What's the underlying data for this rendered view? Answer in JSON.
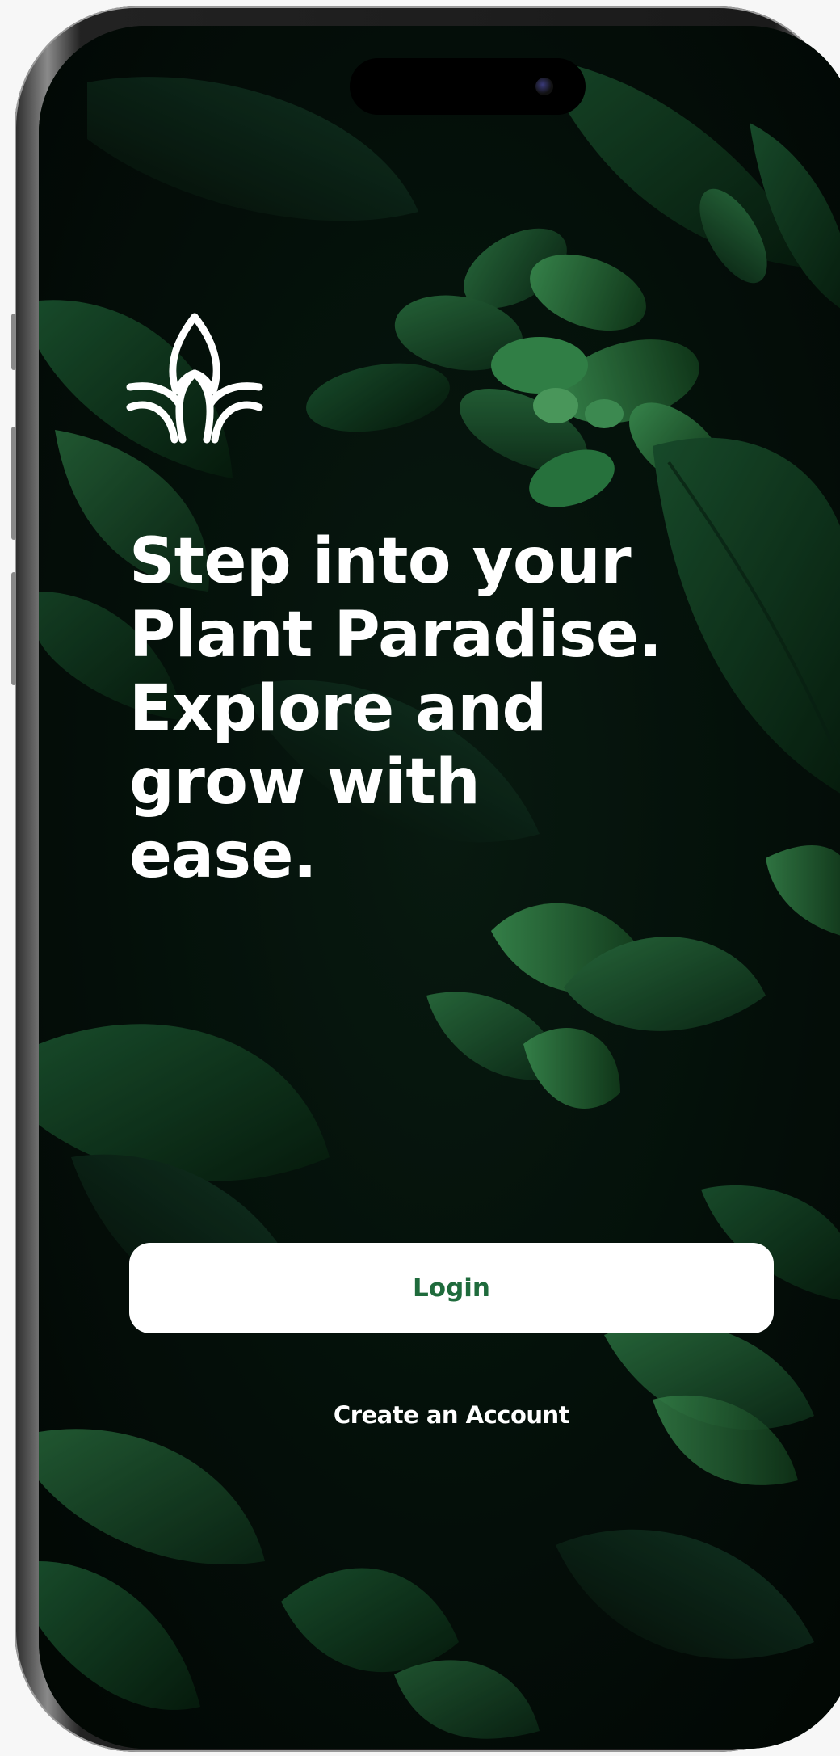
{
  "app": {
    "logo_icon": "lotus-leaf-icon",
    "headline_lines": [
      "Step into your",
      "Plant Paradise.",
      "Explore and",
      "grow with",
      "ease."
    ]
  },
  "actions": {
    "login_label": "Login",
    "create_account_label": "Create an Account"
  },
  "colors": {
    "primary_green": "#1f6b3c",
    "background_dark": "#041008",
    "text_light": "#ffffff"
  }
}
